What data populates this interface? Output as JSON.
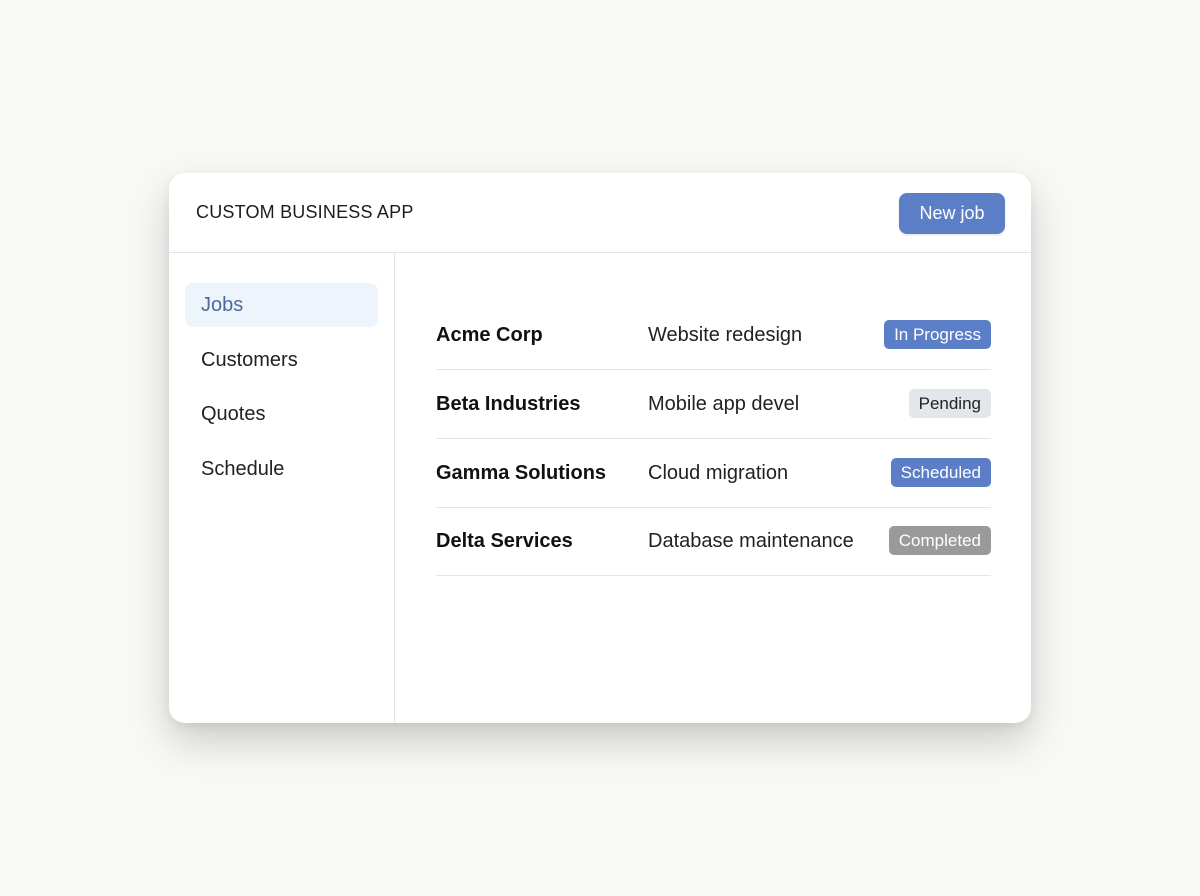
{
  "app": {
    "title": "CUSTOM BUSINESS APP",
    "new_job_label": "New job",
    "accent_color": "#5b7ec6"
  },
  "sidebar": {
    "items": [
      {
        "label": "Jobs",
        "active": true
      },
      {
        "label": "Customers",
        "active": false
      },
      {
        "label": "Quotes",
        "active": false
      },
      {
        "label": "Schedule",
        "active": false
      }
    ]
  },
  "jobs": [
    {
      "customer": "Acme Corp",
      "title": "Website redesign",
      "status": "In Progress",
      "status_color": "#5b7ec6"
    },
    {
      "customer": "Beta Industries",
      "title": "Mobile app devel",
      "status": "Pending",
      "status_color": "#e3e6ea"
    },
    {
      "customer": "Gamma Solutions",
      "title": "Cloud migration",
      "status": "Scheduled",
      "status_color": "#5b7ec6"
    },
    {
      "customer": "Delta Services",
      "title": "Database maintenance",
      "status": "Completed",
      "status_color": "#9a9a9a"
    }
  ]
}
